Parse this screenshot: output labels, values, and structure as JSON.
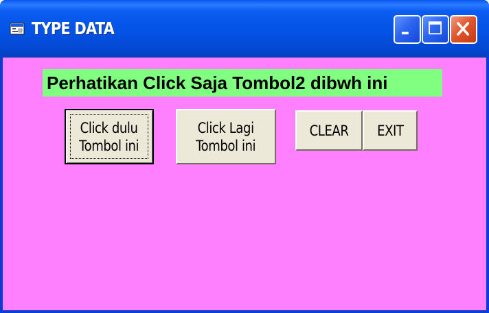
{
  "window": {
    "title": "TYPE DATA",
    "icon": "form-icon",
    "controls": {
      "minimize_icon": "minimize-icon",
      "maximize_icon": "maximize-icon",
      "close_icon": "close-icon"
    }
  },
  "form": {
    "background_color": "#ff80ff",
    "label": {
      "text": "Perhatikan Click Saja Tombol2 dibwh ini",
      "background_color": "#80ff80"
    },
    "buttons": [
      {
        "label": "Click dulu\nTombol ini",
        "focused": true
      },
      {
        "label": "Click Lagi\nTombol ini",
        "focused": false
      },
      {
        "label": "CLEAR",
        "focused": false
      },
      {
        "label": "EXIT",
        "focused": false
      }
    ]
  }
}
